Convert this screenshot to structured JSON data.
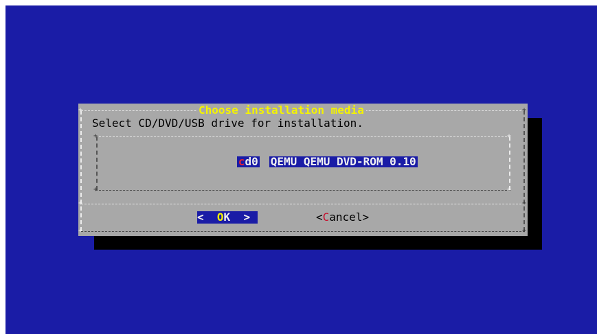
{
  "dialog": {
    "title": "Choose installation media",
    "prompt": "Select CD/DVD/USB drive for installation."
  },
  "menu": {
    "items": [
      {
        "tag_hotkey": "c",
        "tag_rest": "d0",
        "description": "QEMU QEMU DVD-ROM 0.10"
      }
    ]
  },
  "buttons": {
    "ok": {
      "left": "<  ",
      "hotkey": "O",
      "rest": "K  >"
    },
    "cancel": {
      "open": "<",
      "hotkey": "C",
      "rest": "ancel>"
    }
  },
  "colors": {
    "background": "#1a1ca6",
    "dialog": "#a8a8a8",
    "title": "#f4f300",
    "hotkey": "#e0203a"
  }
}
